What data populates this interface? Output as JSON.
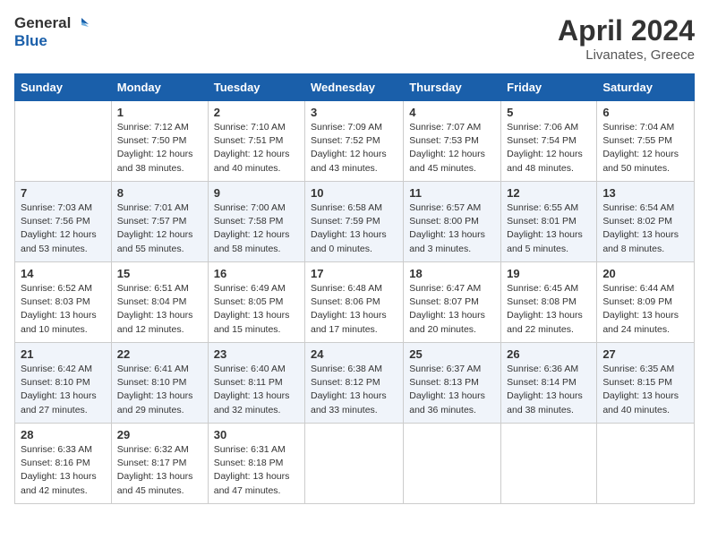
{
  "header": {
    "logo_general": "General",
    "logo_blue": "Blue",
    "month_title": "April 2024",
    "location": "Livanates, Greece"
  },
  "calendar": {
    "days_of_week": [
      "Sunday",
      "Monday",
      "Tuesday",
      "Wednesday",
      "Thursday",
      "Friday",
      "Saturday"
    ],
    "weeks": [
      [
        {
          "day": "",
          "empty": true
        },
        {
          "day": "1",
          "sunrise": "7:12 AM",
          "sunset": "7:50 PM",
          "daylight": "12 hours and 38 minutes."
        },
        {
          "day": "2",
          "sunrise": "7:10 AM",
          "sunset": "7:51 PM",
          "daylight": "12 hours and 40 minutes."
        },
        {
          "day": "3",
          "sunrise": "7:09 AM",
          "sunset": "7:52 PM",
          "daylight": "12 hours and 43 minutes."
        },
        {
          "day": "4",
          "sunrise": "7:07 AM",
          "sunset": "7:53 PM",
          "daylight": "12 hours and 45 minutes."
        },
        {
          "day": "5",
          "sunrise": "7:06 AM",
          "sunset": "7:54 PM",
          "daylight": "12 hours and 48 minutes."
        },
        {
          "day": "6",
          "sunrise": "7:04 AM",
          "sunset": "7:55 PM",
          "daylight": "12 hours and 50 minutes."
        }
      ],
      [
        {
          "day": "7",
          "sunrise": "7:03 AM",
          "sunset": "7:56 PM",
          "daylight": "12 hours and 53 minutes."
        },
        {
          "day": "8",
          "sunrise": "7:01 AM",
          "sunset": "7:57 PM",
          "daylight": "12 hours and 55 minutes."
        },
        {
          "day": "9",
          "sunrise": "7:00 AM",
          "sunset": "7:58 PM",
          "daylight": "12 hours and 58 minutes."
        },
        {
          "day": "10",
          "sunrise": "6:58 AM",
          "sunset": "7:59 PM",
          "daylight": "13 hours and 0 minutes."
        },
        {
          "day": "11",
          "sunrise": "6:57 AM",
          "sunset": "8:00 PM",
          "daylight": "13 hours and 3 minutes."
        },
        {
          "day": "12",
          "sunrise": "6:55 AM",
          "sunset": "8:01 PM",
          "daylight": "13 hours and 5 minutes."
        },
        {
          "day": "13",
          "sunrise": "6:54 AM",
          "sunset": "8:02 PM",
          "daylight": "13 hours and 8 minutes."
        }
      ],
      [
        {
          "day": "14",
          "sunrise": "6:52 AM",
          "sunset": "8:03 PM",
          "daylight": "13 hours and 10 minutes."
        },
        {
          "day": "15",
          "sunrise": "6:51 AM",
          "sunset": "8:04 PM",
          "daylight": "13 hours and 12 minutes."
        },
        {
          "day": "16",
          "sunrise": "6:49 AM",
          "sunset": "8:05 PM",
          "daylight": "13 hours and 15 minutes."
        },
        {
          "day": "17",
          "sunrise": "6:48 AM",
          "sunset": "8:06 PM",
          "daylight": "13 hours and 17 minutes."
        },
        {
          "day": "18",
          "sunrise": "6:47 AM",
          "sunset": "8:07 PM",
          "daylight": "13 hours and 20 minutes."
        },
        {
          "day": "19",
          "sunrise": "6:45 AM",
          "sunset": "8:08 PM",
          "daylight": "13 hours and 22 minutes."
        },
        {
          "day": "20",
          "sunrise": "6:44 AM",
          "sunset": "8:09 PM",
          "daylight": "13 hours and 24 minutes."
        }
      ],
      [
        {
          "day": "21",
          "sunrise": "6:42 AM",
          "sunset": "8:10 PM",
          "daylight": "13 hours and 27 minutes."
        },
        {
          "day": "22",
          "sunrise": "6:41 AM",
          "sunset": "8:10 PM",
          "daylight": "13 hours and 29 minutes."
        },
        {
          "day": "23",
          "sunrise": "6:40 AM",
          "sunset": "8:11 PM",
          "daylight": "13 hours and 32 minutes."
        },
        {
          "day": "24",
          "sunrise": "6:38 AM",
          "sunset": "8:12 PM",
          "daylight": "13 hours and 33 minutes."
        },
        {
          "day": "25",
          "sunrise": "6:37 AM",
          "sunset": "8:13 PM",
          "daylight": "13 hours and 36 minutes."
        },
        {
          "day": "26",
          "sunrise": "6:36 AM",
          "sunset": "8:14 PM",
          "daylight": "13 hours and 38 minutes."
        },
        {
          "day": "27",
          "sunrise": "6:35 AM",
          "sunset": "8:15 PM",
          "daylight": "13 hours and 40 minutes."
        }
      ],
      [
        {
          "day": "28",
          "sunrise": "6:33 AM",
          "sunset": "8:16 PM",
          "daylight": "13 hours and 42 minutes."
        },
        {
          "day": "29",
          "sunrise": "6:32 AM",
          "sunset": "8:17 PM",
          "daylight": "13 hours and 45 minutes."
        },
        {
          "day": "30",
          "sunrise": "6:31 AM",
          "sunset": "8:18 PM",
          "daylight": "13 hours and 47 minutes."
        },
        {
          "day": "",
          "empty": true
        },
        {
          "day": "",
          "empty": true
        },
        {
          "day": "",
          "empty": true
        },
        {
          "day": "",
          "empty": true
        }
      ]
    ]
  }
}
